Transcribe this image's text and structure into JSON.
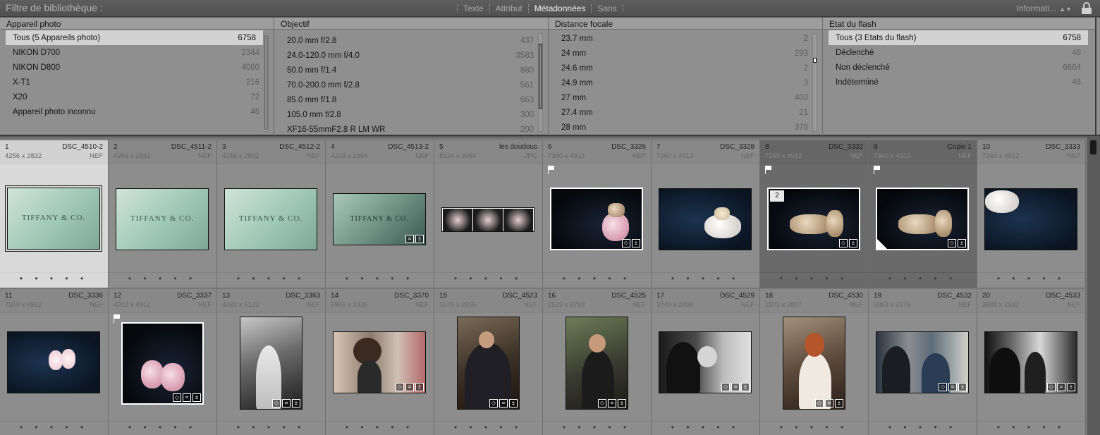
{
  "filter_bar": {
    "title": "Filtre de bibliothèque :",
    "modes": [
      "Texte",
      "Attribut",
      "Métadonnées",
      "Sans"
    ],
    "active_mode": "Métadonnées",
    "preset": "Informati...",
    "preset_chevron": "▲▼"
  },
  "columns": [
    {
      "header": "Appareil photo",
      "rows": [
        {
          "label": "Tous (5 Appareils photo)",
          "count": "6758",
          "selected": true
        },
        {
          "label": "NIKON D700",
          "count": "2344"
        },
        {
          "label": "NIKON D800",
          "count": "4080"
        },
        {
          "label": "X-T1",
          "count": "216"
        },
        {
          "label": "X20",
          "count": "72"
        },
        {
          "label": "Appareil photo inconnu",
          "count": "46"
        }
      ]
    },
    {
      "header": "Objectif",
      "rows": [
        {
          "label": "20.0 mm f/2.8",
          "count": "437"
        },
        {
          "label": "24.0-120.0 mm f/4.0",
          "count": "3583"
        },
        {
          "label": "50.0 mm f/1.4",
          "count": "880"
        },
        {
          "label": "70.0-200.0 mm f/2.8",
          "count": "561"
        },
        {
          "label": "85.0 mm f/1.8",
          "count": "663"
        },
        {
          "label": "105.0 mm f/2.8",
          "count": "300"
        },
        {
          "label": "XF16-55mmF2.8 R LM WR",
          "count": "200"
        }
      ]
    },
    {
      "header": "Distance focale",
      "rows": [
        {
          "label": "23.7 mm",
          "count": "2"
        },
        {
          "label": "24 mm",
          "count": "293"
        },
        {
          "label": "24.6 mm",
          "count": "2"
        },
        {
          "label": "24.9 mm",
          "count": "3"
        },
        {
          "label": "27 mm",
          "count": "400"
        },
        {
          "label": "27.4 mm",
          "count": "21"
        },
        {
          "label": "28 mm",
          "count": "370"
        }
      ]
    },
    {
      "header": "Etat du flash",
      "rows": [
        {
          "label": "Tous (3 Etats du flash)",
          "count": "6758",
          "selected": true
        },
        {
          "label": "Déclenché",
          "count": "48"
        },
        {
          "label": "Non déclenché",
          "count": "6664"
        },
        {
          "label": "Indéterminé",
          "count": "46"
        }
      ]
    }
  ],
  "grid": {
    "stars": "• • • • •",
    "cells": [
      {
        "idx": "1",
        "name": "DSC_4510-2",
        "dims": "4256 x 2832",
        "ext": "NEF"
      },
      {
        "idx": "2",
        "name": "DSC_4511-2",
        "dims": "4256 x 2832",
        "ext": "NEF"
      },
      {
        "idx": "3",
        "name": "DSC_4512-2",
        "dims": "4256 x 2832",
        "ext": "NEF"
      },
      {
        "idx": "4",
        "name": "DSC_4513-2",
        "dims": "4203 x 2364",
        "ext": "NEF"
      },
      {
        "idx": "5",
        "name": "les doudous",
        "dims": "8124 x 2064",
        "ext": "JPG"
      },
      {
        "idx": "6",
        "name": "DSC_3326",
        "dims": "7360 x 4912",
        "ext": "NEF"
      },
      {
        "idx": "7",
        "name": "DSC_3328",
        "dims": "7360 x 4912",
        "ext": "NEF"
      },
      {
        "idx": "8",
        "name": "DSC_3332",
        "dims": "7360 x 4912",
        "ext": "NEF",
        "stack": "2"
      },
      {
        "idx": "9",
        "name": "Copie 1",
        "dims": "7360 x 4912",
        "ext": "NEF"
      },
      {
        "idx": "10",
        "name": "DSC_3333",
        "dims": "7360 x 4912",
        "ext": "NEF"
      },
      {
        "idx": "11",
        "name": "DSC_3336",
        "dims": "7360 x 4912",
        "ext": "NEF"
      },
      {
        "idx": "12",
        "name": "DSC_3337",
        "dims": "4912 x 4912",
        "ext": "NEF"
      },
      {
        "idx": "13",
        "name": "DSC_3363",
        "dims": "4082 x 6123",
        "ext": "NEF"
      },
      {
        "idx": "14",
        "name": "DSC_3370",
        "dims": "5905 x 3936",
        "ext": "NEF"
      },
      {
        "idx": "15",
        "name": "DSC_4523",
        "dims": "1970 x 2955",
        "ext": "NEF"
      },
      {
        "idx": "16",
        "name": "DSC_4525",
        "dims": "2529 x 3793",
        "ext": "NEF"
      },
      {
        "idx": "17",
        "name": "DSC_4529",
        "dims": "3749 x 2499",
        "ext": "NEF"
      },
      {
        "idx": "18",
        "name": "DSC_4530",
        "dims": "1871 x 2807",
        "ext": "NEF"
      },
      {
        "idx": "19",
        "name": "DSC_4532",
        "dims": "3863 x 2575",
        "ext": "NEF"
      },
      {
        "idx": "20",
        "name": "DSC_4533",
        "dims": "3888 x 2592",
        "ext": "NEF"
      }
    ]
  },
  "tiffany_logo": "TIFFANY & CO.",
  "colors": {
    "panel": "#8f8f8f",
    "selected_cell": "#d9d9d9",
    "active_mode": "#f2f2f2"
  }
}
